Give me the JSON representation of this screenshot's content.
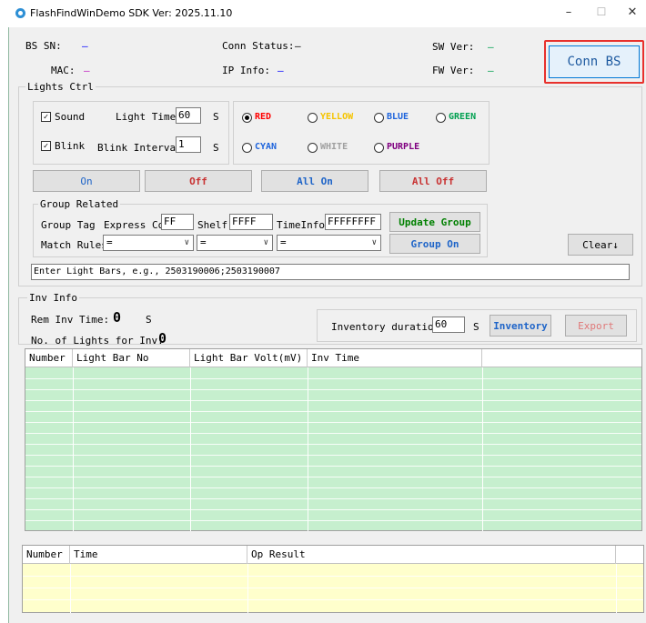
{
  "window": {
    "title": "FlashFindWinDemo SDK Ver: 2025.11.10",
    "minimize": "–",
    "maximize": "☐",
    "close": "✕"
  },
  "info": {
    "bs_sn_label": "BS SN:",
    "bs_sn_value": "—",
    "conn_status_label": "Conn Status:",
    "conn_status_value": "—",
    "sw_ver_label": "SW Ver:",
    "sw_ver_value": "—",
    "mac_label": "MAC:",
    "mac_value": "—",
    "ip_info_label": "IP Info:",
    "ip_info_value": "—",
    "fw_ver_label": "FW Ver:",
    "fw_ver_value": "—",
    "conn_bs_button": "Conn BS"
  },
  "lights_ctrl": {
    "group_label": "Lights Ctrl",
    "sound_label": "Sound",
    "sound_checked": true,
    "blink_label": "Blink",
    "blink_checked": true,
    "light_time_label": "Light Time",
    "light_time_value": "60",
    "light_time_unit": "S",
    "blink_interval_label": "Blink Interval",
    "blink_interval_value": "1",
    "blink_interval_unit": "S",
    "colors": [
      {
        "label": "RED",
        "color": "#ff0000",
        "selected": true
      },
      {
        "label": "YELLOW",
        "color": "#f5c400",
        "selected": false
      },
      {
        "label": "BLUE",
        "color": "#1e64dc",
        "selected": false
      },
      {
        "label": "GREEN",
        "color": "#00a050",
        "selected": false
      },
      {
        "label": "CYAN",
        "color": "#1e64dc",
        "selected": false
      },
      {
        "label": "WHITE",
        "color": "#a0a0a0",
        "selected": false
      },
      {
        "label": "PURPLE",
        "color": "#800080",
        "selected": false
      }
    ],
    "on_button": "On",
    "off_button": "Off",
    "all_on_button": "All On",
    "all_off_button": "All Off"
  },
  "group_related": {
    "group_label": "Group Related",
    "group_tag_label": "Group Tag",
    "express_co_label": "Express Co",
    "express_co_value": "FF",
    "shelf_label": "Shelf",
    "shelf_value": "FFFF",
    "timeinfo_label": "TimeInfo",
    "timeinfo_value": "FFFFFFFF",
    "update_group_button": "Update Group",
    "match_rules_label": "Match Rules",
    "match_rule_1": "=",
    "match_rule_2": "=",
    "match_rule_3": "=",
    "group_on_button": "Group On",
    "clear_button": "Clear"
  },
  "light_bars_input": {
    "placeholder": "Enter Light Bars, e.g., 2503190006;2503190007"
  },
  "inv_info": {
    "group_label": "Inv Info",
    "rem_inv_time_label": "Rem Inv Time:",
    "rem_inv_time_value": "0",
    "rem_inv_time_unit": "S",
    "lights_for_inv_label": "No. of Lights for Inv:",
    "lights_for_inv_value": "0",
    "inventory_duration_label": "Inventory duration",
    "inventory_duration_value": "60",
    "inventory_duration_unit": "S",
    "inventory_button": "Inventory",
    "export_button": "Export"
  },
  "inv_table": {
    "columns": [
      "Number",
      "Light Bar No",
      "Light Bar Volt(mV)",
      "Inv Time",
      ""
    ]
  },
  "log_table": {
    "columns": [
      "Number",
      "Time",
      "Op Result",
      ""
    ]
  },
  "colors": {
    "button_text_blue": "#1e64c8",
    "button_text_red": "#c83232",
    "button_text_green": "#008000",
    "export_disabled": "#e07878",
    "highlight_red": "#e8312c",
    "green_grid": "#c6efce",
    "yellow_grid": "#ffffcc"
  }
}
